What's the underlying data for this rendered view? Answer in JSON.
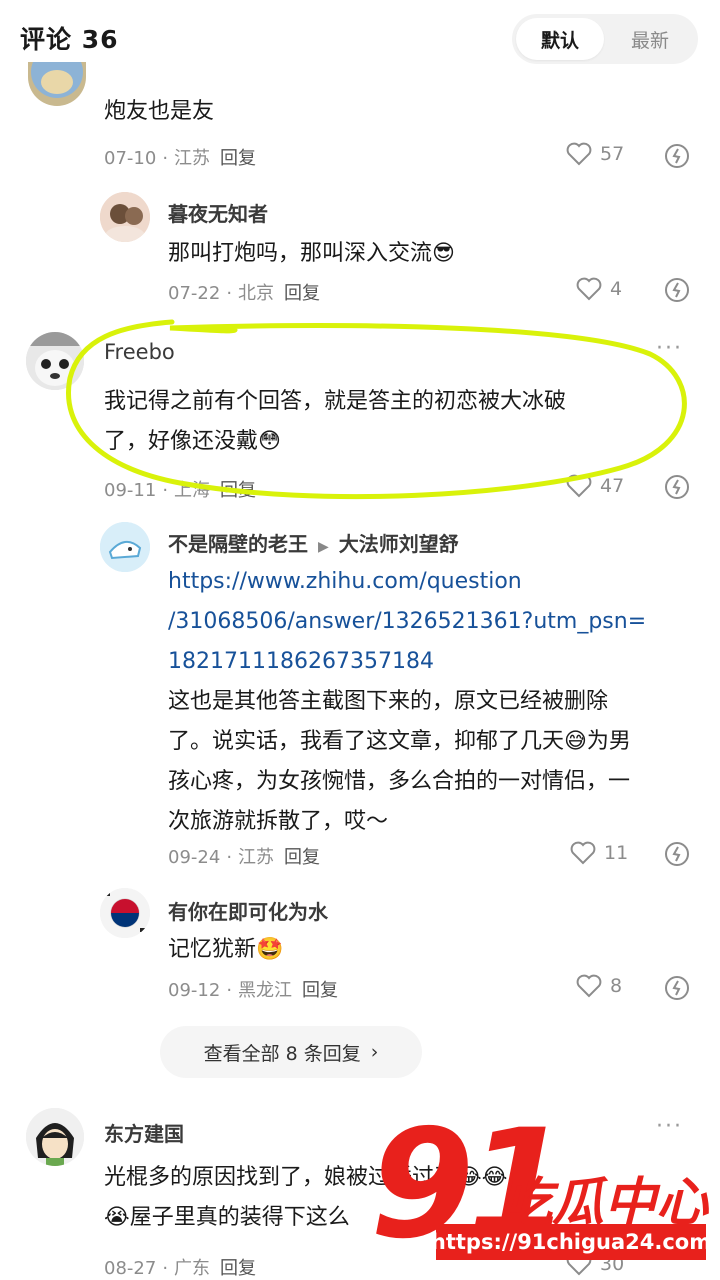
{
  "header": {
    "title": "评论 36",
    "sort_default": "默认",
    "sort_latest": "最新"
  },
  "comments": [
    {
      "text": "炮友也是友",
      "date": "07-10",
      "location": "江苏",
      "reply": "回复",
      "likes": "57"
    },
    {
      "user": "暮夜无知者",
      "text": "那叫打炮吗，那叫深入交流😎",
      "date": "07-22",
      "location": "北京",
      "reply": "回复",
      "likes": "4"
    },
    {
      "user": "Freebo",
      "text_line1": "我记得之前有个回答，就是答主的初恋被大冰破",
      "text_line2": "了，好像还没戴😳",
      "date": "09-11",
      "location": "上海",
      "reply": "回复",
      "likes": "47"
    },
    {
      "user": "不是隔壁的老王",
      "reply_to": "大法师刘望舒",
      "link_line1": "https://www.zhihu.com/question",
      "link_line2": "/31068506/answer/1326521361?utm_psn=",
      "link_line3": "1821711186267357184",
      "text_line1": "这也是其他答主截图下来的，原文已经被删除",
      "text_line2": "了。说实话，我看了这文章，抑郁了几天😅为男",
      "text_line3": "孩心疼，为女孩惋惜，多么合拍的一对情侣，一",
      "text_line4": "次旅游就拆散了，哎～",
      "date": "09-24",
      "location": "江苏",
      "reply": "回复",
      "likes": "11"
    },
    {
      "user": "有你在即可化为水",
      "text": "记忆犹新🤩",
      "date": "09-12",
      "location": "黑龙江",
      "reply": "回复",
      "likes": "8"
    },
    {
      "user": "东方建国",
      "text_line1": "光棍多的原因找到了，",
      "text_line1b": "娘",
      "text_line1c": "被",
      "text_line1d": "过睡过了😂😂",
      "text_line2": "😭屋子里真的装得下这么",
      "date": "08-27",
      "location": "广东",
      "reply": "回复",
      "likes": "30"
    }
  ],
  "view_all": "查看全部 8 条回复",
  "watermark": {
    "number": "91",
    "name": "吃瓜中心",
    "url": "https://91chigua24.com"
  },
  "colors": {
    "highlight": "#d9f20a",
    "link": "#175199",
    "watermark": "#e8211c"
  }
}
